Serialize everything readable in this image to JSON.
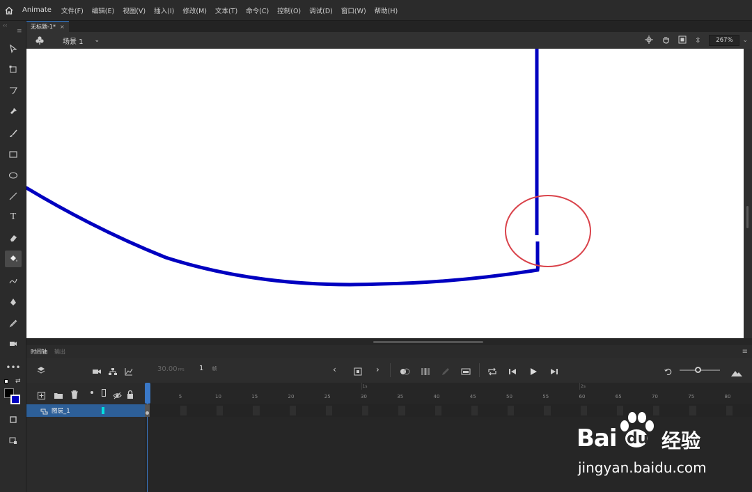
{
  "app": {
    "name": "Animate"
  },
  "menu": [
    "文件(F)",
    "编辑(E)",
    "视图(V)",
    "插入(I)",
    "修改(M)",
    "文本(T)",
    "命令(C)",
    "控制(O)",
    "调试(D)",
    "窗口(W)",
    "帮助(H)"
  ],
  "document": {
    "tab_title": "无标题-1*",
    "close_glyph": "×"
  },
  "scene": {
    "label": "场景 1",
    "zoom": "267%"
  },
  "timeline": {
    "tab_active": "时间轴",
    "tab_output": "输出",
    "fps": "30.00",
    "fps_unit": "FPS",
    "frame": "1",
    "frame_unit": "帧",
    "layer_name": "图层_1",
    "second_markers": [
      "1s",
      "2s"
    ],
    "frame_numbers": [
      "5",
      "10",
      "15",
      "20",
      "25",
      "30",
      "35",
      "40",
      "45",
      "50",
      "55",
      "60",
      "65",
      "70",
      "75",
      "80"
    ]
  },
  "watermark": {
    "brand": "Bai",
    "brand2": "du",
    "brand_cn": "经验",
    "url": "jingyan.baidu.com"
  },
  "colors": {
    "stroke": "#0000c0",
    "highlight_circle": "#d9424a",
    "accent": "#2f7bd6",
    "stage_bg": "#ffffff"
  }
}
